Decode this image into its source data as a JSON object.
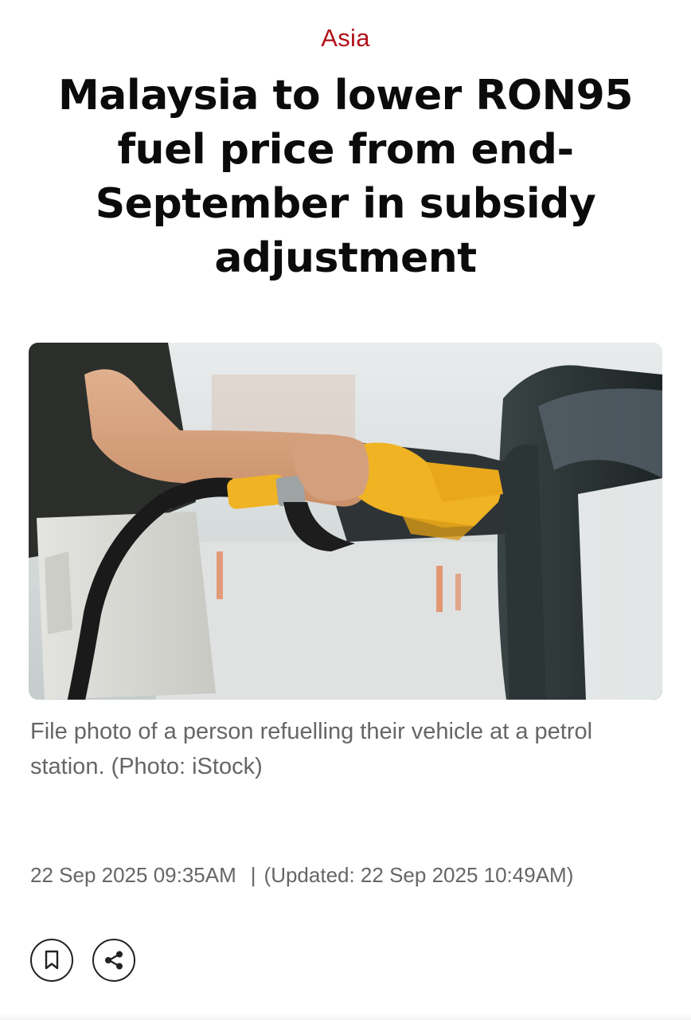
{
  "article": {
    "section": "Asia",
    "title": "Malaysia to lower RON95 fuel price from end-September in subsidy adjustment",
    "image": {
      "caption": "File photo of a person refuelling their vehicle at a petrol station. (Photo: iStock)"
    },
    "published": "22 Sep 2025 09:35AM",
    "separator": "|",
    "updated": "(Updated: 22 Sep 2025 10:49AM)"
  },
  "actions": {
    "bookmark_icon": "bookmark-icon",
    "share_icon": "share-icon"
  },
  "colors": {
    "section": "#b01218",
    "headline": "#0b0b0b",
    "muted_text": "#666666",
    "nozzle_yellow": "#f0b323"
  }
}
